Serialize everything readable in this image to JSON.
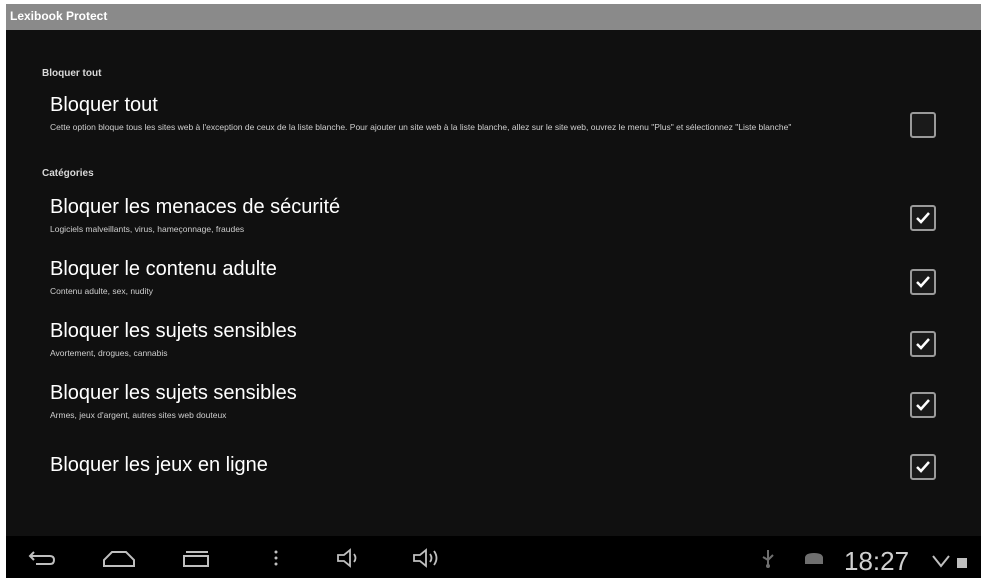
{
  "window": {
    "title": "Lexibook Protect"
  },
  "sections": [
    {
      "header": "Bloquer tout"
    },
    {
      "header": "Catégories"
    }
  ],
  "settings": [
    {
      "title": "Bloquer tout",
      "summary": "Cette option bloque tous les sites web à l'exception de ceux de la liste blanche. Pour ajouter un site web à la liste blanche, allez sur le site web, ouvrez le menu \"Plus\" et sélectionnez \"Liste blanche\"",
      "checked": false
    },
    {
      "title": "Bloquer les menaces de sécurité",
      "summary": "Logiciels malveillants, virus, hameçonnage, fraudes",
      "checked": true
    },
    {
      "title": "Bloquer le contenu adulte",
      "summary": "Contenu adulte, sex, nudity",
      "checked": true
    },
    {
      "title": "Bloquer les sujets sensibles",
      "summary": "Avortement, drogues, cannabis",
      "checked": true
    },
    {
      "title": "Bloquer les sujets sensibles",
      "summary": "Armes, jeux d'argent, autres sites web douteux",
      "checked": true
    },
    {
      "title": "Bloquer les jeux en ligne",
      "summary": "",
      "checked": true
    }
  ],
  "navbar": {
    "buttons": [
      "back-icon",
      "home-icon",
      "recent-apps-icon",
      "menu-icon",
      "volume-down-icon",
      "volume-up-icon"
    ]
  },
  "status": {
    "time": "18:27",
    "icons": [
      "usb-icon",
      "android-icon",
      "wifi-icon",
      "battery-icon"
    ]
  },
  "colors": {
    "background": "#101010",
    "titlebar": "#8a8a8a",
    "navbar": "#000000",
    "checkmark": "#ffffff"
  }
}
